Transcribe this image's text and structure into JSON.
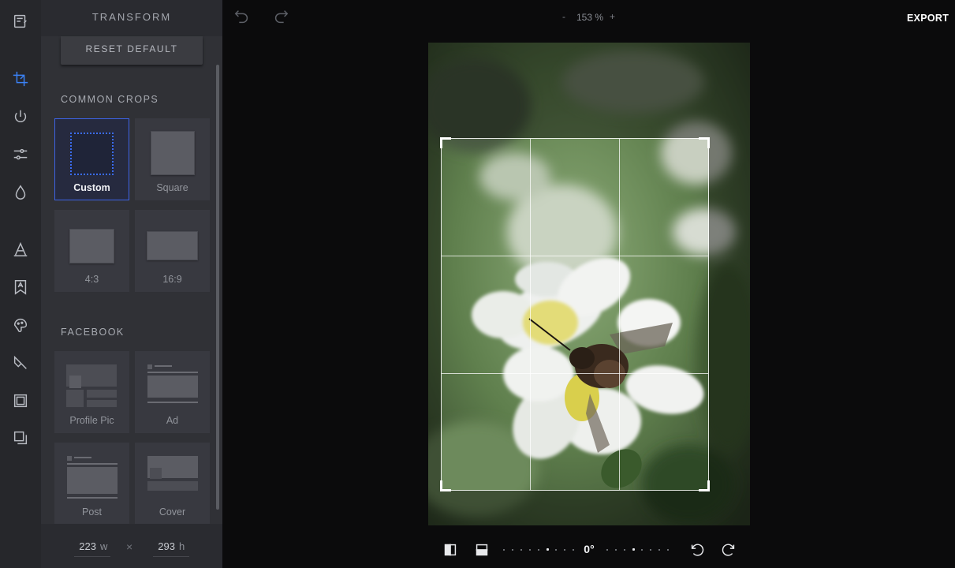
{
  "panel": {
    "title": "TRANSFORM",
    "reset_label": "RESET DEFAULT",
    "common_crops_label": "COMMON CROPS",
    "facebook_label": "FACEBOOK",
    "common_crops": [
      {
        "label": "Custom",
        "selected": true
      },
      {
        "label": "Square",
        "selected": false
      },
      {
        "label": "4:3",
        "selected": false
      },
      {
        "label": "16:9",
        "selected": false
      }
    ],
    "facebook_crops": [
      {
        "label": "Profile Pic"
      },
      {
        "label": "Ad"
      },
      {
        "label": "Post"
      },
      {
        "label": "Cover"
      }
    ],
    "size": {
      "width": "223",
      "width_unit": "w",
      "separator": "×",
      "height": "293",
      "height_unit": "h"
    }
  },
  "rail_tools": [
    {
      "name": "document-icon"
    },
    {
      "name": "crop-icon",
      "active": true
    },
    {
      "name": "filter-icon"
    },
    {
      "name": "adjust-sliders-icon"
    },
    {
      "name": "drop-icon"
    },
    {
      "name": "text-icon"
    },
    {
      "name": "sticker-icon"
    },
    {
      "name": "brush-icon"
    },
    {
      "name": "paint-icon"
    },
    {
      "name": "frame-icon"
    },
    {
      "name": "overlay-icon"
    }
  ],
  "topbar": {
    "zoom_minus": "-",
    "zoom_value": "153 %",
    "zoom_plus": "+",
    "export_label": "EXPORT"
  },
  "bottombar": {
    "angle": "0°"
  },
  "colors": {
    "accent": "#3b6cf5",
    "panel_bg": "#303136",
    "rail_bg": "#26272b",
    "canvas_bg": "#0b0b0c"
  }
}
